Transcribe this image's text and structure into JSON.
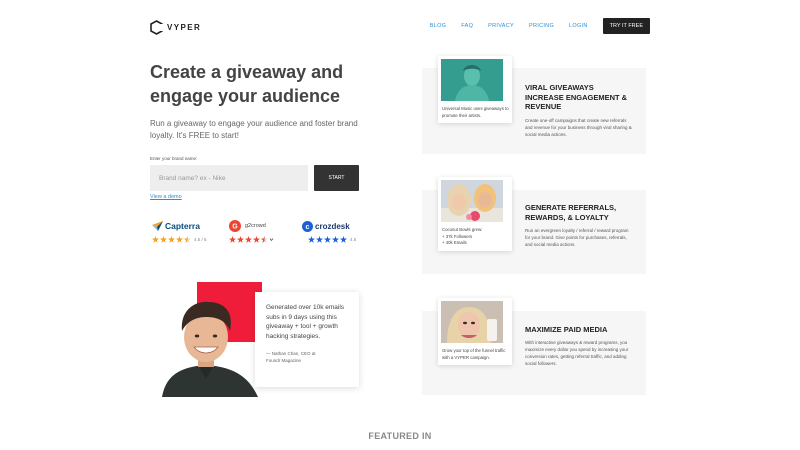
{
  "header": {
    "logo_text": "VYPER",
    "nav": [
      {
        "label": "BLOG"
      },
      {
        "label": "FAQ"
      },
      {
        "label": "PRIVACY"
      },
      {
        "label": "PRICING"
      },
      {
        "label": "LOGIN"
      }
    ],
    "cta_label": "TRY IT FREE"
  },
  "hero": {
    "title_line1": "Create a giveaway and",
    "title_line2": "engage your audience",
    "subtitle": "Run a giveaway to engage your audience and foster brand loyalty. It's FREE to start!",
    "brand_label": "Enter your brand name:",
    "brand_placeholder": "Brand name? ex - Nike",
    "start_label": "START",
    "demo_link": "View a demo"
  },
  "reviews": [
    {
      "name": "Capterra",
      "rating": "4.5 / 5",
      "icon": "capterra-icon",
      "star_color": "#f6a21c"
    },
    {
      "name": "g2crowd",
      "rating": "",
      "icon": "g2crowd-icon",
      "star_color": "#ee4430"
    },
    {
      "name": "crozdesk",
      "rating": "4.6",
      "icon": "crozdesk-icon",
      "star_color": "#1e5fd6"
    }
  ],
  "testimonial": {
    "quote": "Generated over 10k emails subs in 9 days using this giveaway + tool + growth hacking strategies.",
    "author_line1": "— Nathan Chan, CEO at",
    "author_line2": "Foundr Magazine"
  },
  "features": [
    {
      "caption": "Universal Music uses giveaways to promote their artists.",
      "title_lines": [
        "VIRAL GIVEAWAYS",
        "INCREASE ENGAGEMENT &",
        "REVENUE"
      ],
      "description": "Create one-off campaigns that create new referrals and revenue for your business through viral sharing & social media actions."
    },
    {
      "caption_lines": [
        "Coconut Bowls grew:",
        "+ 37k Followers",
        "+ 40k Emails"
      ],
      "title_lines": [
        "GENERATE REFERRALS,",
        "REWARDS, & LOYALTY"
      ],
      "description": "Run an evergreen loyalty / referral / reward program for your brand. Give points for purchases, referrals, and social media actions."
    },
    {
      "caption": "Grow your top of the funnel traffic with a VYPER campaign.",
      "title_lines": [
        "MAXIMIZE PAID MEDIA"
      ],
      "description": "With interactive giveaways & reward programs, you maximize every dollar you spend by increasing your conversion rates, getting referral traffic, and adding social followers."
    }
  ],
  "featured_in": "FEATURED IN",
  "colors": {
    "accent_link": "#2a8fd9",
    "cta_bg": "#222222",
    "red_block": "#f01d3a"
  }
}
